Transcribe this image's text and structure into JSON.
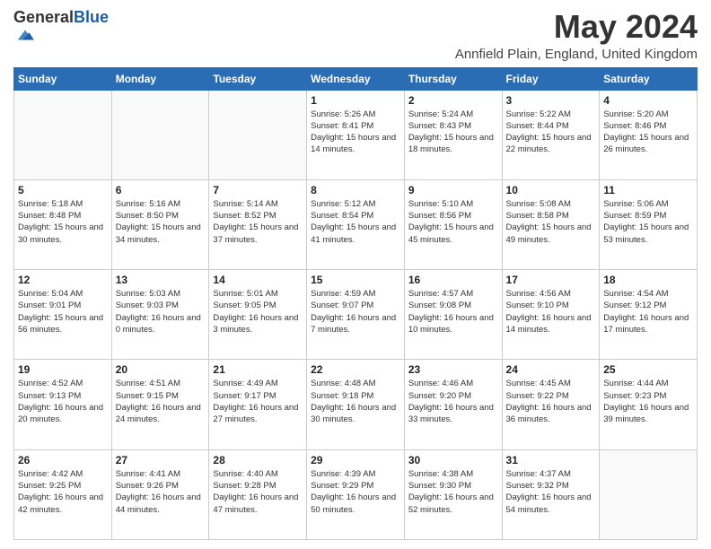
{
  "header": {
    "logo_general": "General",
    "logo_blue": "Blue",
    "month_title": "May 2024",
    "location": "Annfield Plain, England, United Kingdom"
  },
  "days_of_week": [
    "Sunday",
    "Monday",
    "Tuesday",
    "Wednesday",
    "Thursday",
    "Friday",
    "Saturday"
  ],
  "weeks": [
    [
      {
        "day": "",
        "sunrise": "",
        "sunset": "",
        "daylight": ""
      },
      {
        "day": "",
        "sunrise": "",
        "sunset": "",
        "daylight": ""
      },
      {
        "day": "",
        "sunrise": "",
        "sunset": "",
        "daylight": ""
      },
      {
        "day": "1",
        "sunrise": "Sunrise: 5:26 AM",
        "sunset": "Sunset: 8:41 PM",
        "daylight": "Daylight: 15 hours and 14 minutes."
      },
      {
        "day": "2",
        "sunrise": "Sunrise: 5:24 AM",
        "sunset": "Sunset: 8:43 PM",
        "daylight": "Daylight: 15 hours and 18 minutes."
      },
      {
        "day": "3",
        "sunrise": "Sunrise: 5:22 AM",
        "sunset": "Sunset: 8:44 PM",
        "daylight": "Daylight: 15 hours and 22 minutes."
      },
      {
        "day": "4",
        "sunrise": "Sunrise: 5:20 AM",
        "sunset": "Sunset: 8:46 PM",
        "daylight": "Daylight: 15 hours and 26 minutes."
      }
    ],
    [
      {
        "day": "5",
        "sunrise": "Sunrise: 5:18 AM",
        "sunset": "Sunset: 8:48 PM",
        "daylight": "Daylight: 15 hours and 30 minutes."
      },
      {
        "day": "6",
        "sunrise": "Sunrise: 5:16 AM",
        "sunset": "Sunset: 8:50 PM",
        "daylight": "Daylight: 15 hours and 34 minutes."
      },
      {
        "day": "7",
        "sunrise": "Sunrise: 5:14 AM",
        "sunset": "Sunset: 8:52 PM",
        "daylight": "Daylight: 15 hours and 37 minutes."
      },
      {
        "day": "8",
        "sunrise": "Sunrise: 5:12 AM",
        "sunset": "Sunset: 8:54 PM",
        "daylight": "Daylight: 15 hours and 41 minutes."
      },
      {
        "day": "9",
        "sunrise": "Sunrise: 5:10 AM",
        "sunset": "Sunset: 8:56 PM",
        "daylight": "Daylight: 15 hours and 45 minutes."
      },
      {
        "day": "10",
        "sunrise": "Sunrise: 5:08 AM",
        "sunset": "Sunset: 8:58 PM",
        "daylight": "Daylight: 15 hours and 49 minutes."
      },
      {
        "day": "11",
        "sunrise": "Sunrise: 5:06 AM",
        "sunset": "Sunset: 8:59 PM",
        "daylight": "Daylight: 15 hours and 53 minutes."
      }
    ],
    [
      {
        "day": "12",
        "sunrise": "Sunrise: 5:04 AM",
        "sunset": "Sunset: 9:01 PM",
        "daylight": "Daylight: 15 hours and 56 minutes."
      },
      {
        "day": "13",
        "sunrise": "Sunrise: 5:03 AM",
        "sunset": "Sunset: 9:03 PM",
        "daylight": "Daylight: 16 hours and 0 minutes."
      },
      {
        "day": "14",
        "sunrise": "Sunrise: 5:01 AM",
        "sunset": "Sunset: 9:05 PM",
        "daylight": "Daylight: 16 hours and 3 minutes."
      },
      {
        "day": "15",
        "sunrise": "Sunrise: 4:59 AM",
        "sunset": "Sunset: 9:07 PM",
        "daylight": "Daylight: 16 hours and 7 minutes."
      },
      {
        "day": "16",
        "sunrise": "Sunrise: 4:57 AM",
        "sunset": "Sunset: 9:08 PM",
        "daylight": "Daylight: 16 hours and 10 minutes."
      },
      {
        "day": "17",
        "sunrise": "Sunrise: 4:56 AM",
        "sunset": "Sunset: 9:10 PM",
        "daylight": "Daylight: 16 hours and 14 minutes."
      },
      {
        "day": "18",
        "sunrise": "Sunrise: 4:54 AM",
        "sunset": "Sunset: 9:12 PM",
        "daylight": "Daylight: 16 hours and 17 minutes."
      }
    ],
    [
      {
        "day": "19",
        "sunrise": "Sunrise: 4:52 AM",
        "sunset": "Sunset: 9:13 PM",
        "daylight": "Daylight: 16 hours and 20 minutes."
      },
      {
        "day": "20",
        "sunrise": "Sunrise: 4:51 AM",
        "sunset": "Sunset: 9:15 PM",
        "daylight": "Daylight: 16 hours and 24 minutes."
      },
      {
        "day": "21",
        "sunrise": "Sunrise: 4:49 AM",
        "sunset": "Sunset: 9:17 PM",
        "daylight": "Daylight: 16 hours and 27 minutes."
      },
      {
        "day": "22",
        "sunrise": "Sunrise: 4:48 AM",
        "sunset": "Sunset: 9:18 PM",
        "daylight": "Daylight: 16 hours and 30 minutes."
      },
      {
        "day": "23",
        "sunrise": "Sunrise: 4:46 AM",
        "sunset": "Sunset: 9:20 PM",
        "daylight": "Daylight: 16 hours and 33 minutes."
      },
      {
        "day": "24",
        "sunrise": "Sunrise: 4:45 AM",
        "sunset": "Sunset: 9:22 PM",
        "daylight": "Daylight: 16 hours and 36 minutes."
      },
      {
        "day": "25",
        "sunrise": "Sunrise: 4:44 AM",
        "sunset": "Sunset: 9:23 PM",
        "daylight": "Daylight: 16 hours and 39 minutes."
      }
    ],
    [
      {
        "day": "26",
        "sunrise": "Sunrise: 4:42 AM",
        "sunset": "Sunset: 9:25 PM",
        "daylight": "Daylight: 16 hours and 42 minutes."
      },
      {
        "day": "27",
        "sunrise": "Sunrise: 4:41 AM",
        "sunset": "Sunset: 9:26 PM",
        "daylight": "Daylight: 16 hours and 44 minutes."
      },
      {
        "day": "28",
        "sunrise": "Sunrise: 4:40 AM",
        "sunset": "Sunset: 9:28 PM",
        "daylight": "Daylight: 16 hours and 47 minutes."
      },
      {
        "day": "29",
        "sunrise": "Sunrise: 4:39 AM",
        "sunset": "Sunset: 9:29 PM",
        "daylight": "Daylight: 16 hours and 50 minutes."
      },
      {
        "day": "30",
        "sunrise": "Sunrise: 4:38 AM",
        "sunset": "Sunset: 9:30 PM",
        "daylight": "Daylight: 16 hours and 52 minutes."
      },
      {
        "day": "31",
        "sunrise": "Sunrise: 4:37 AM",
        "sunset": "Sunset: 9:32 PM",
        "daylight": "Daylight: 16 hours and 54 minutes."
      },
      {
        "day": "",
        "sunrise": "",
        "sunset": "",
        "daylight": ""
      }
    ]
  ]
}
